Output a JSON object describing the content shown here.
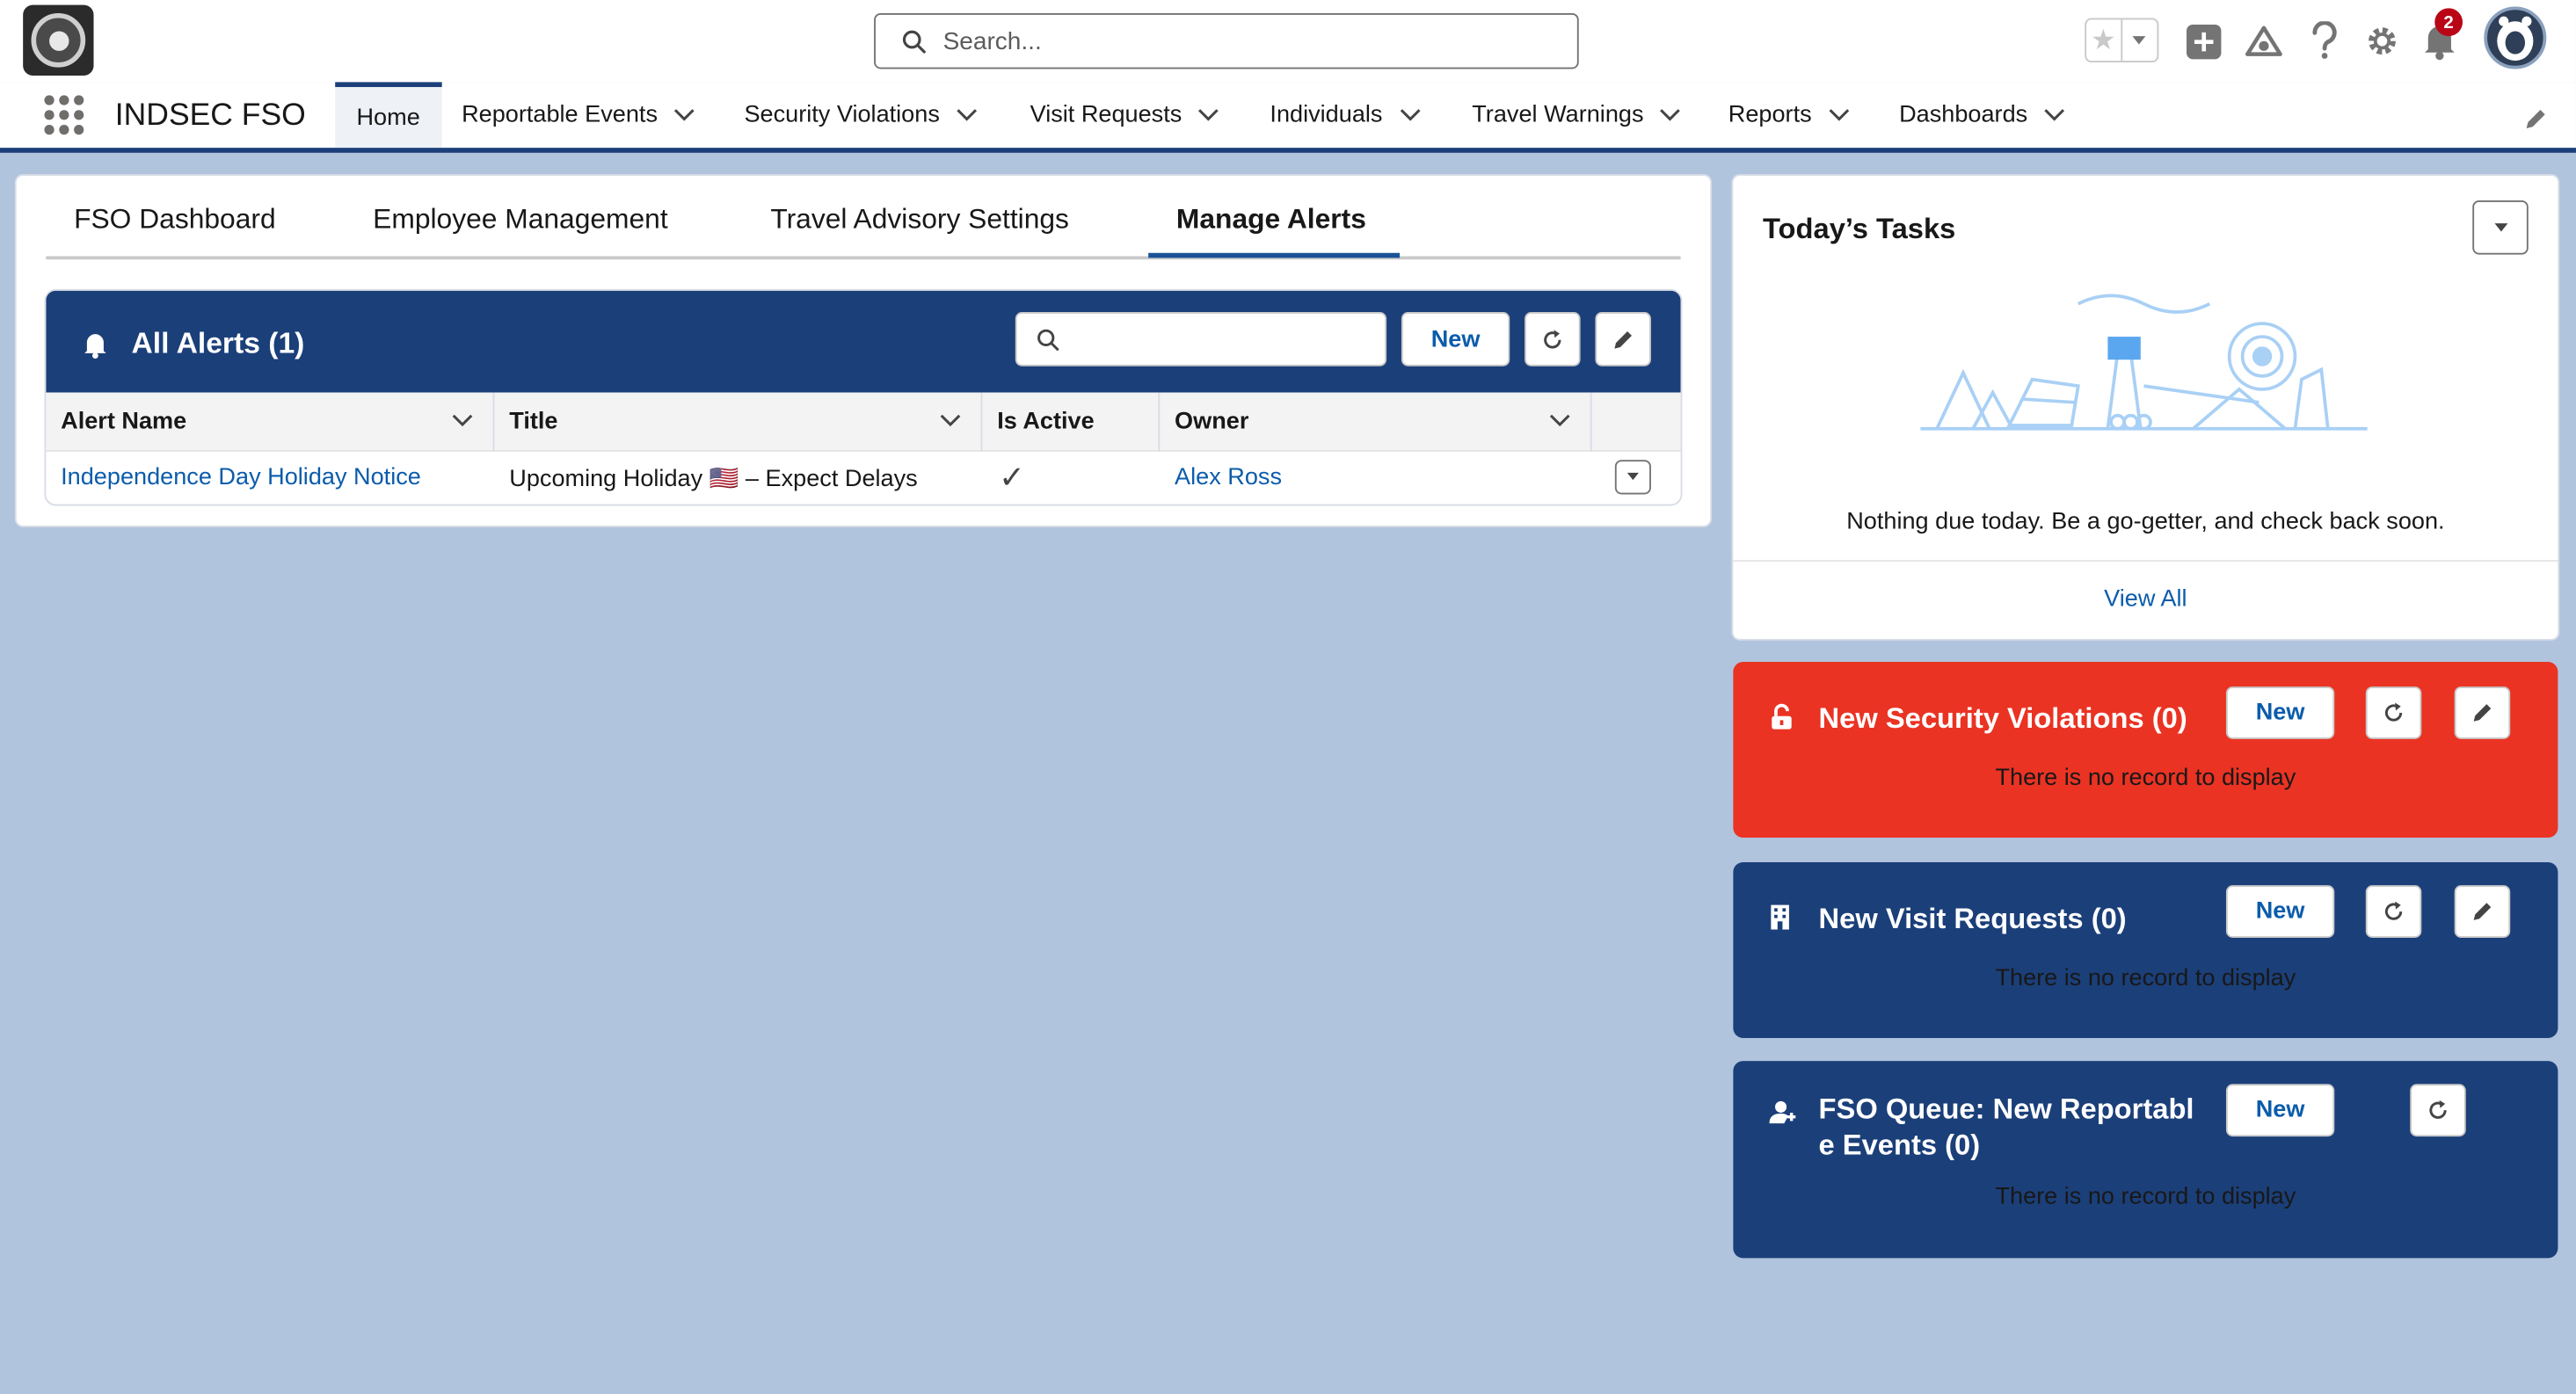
{
  "header": {
    "search_placeholder": "Search...",
    "notification_count": "2"
  },
  "nav": {
    "app_name": "INDSEC FSO",
    "items": [
      {
        "label": "Home"
      },
      {
        "label": "Reportable Events"
      },
      {
        "label": "Security Violations"
      },
      {
        "label": "Visit Requests"
      },
      {
        "label": "Individuals"
      },
      {
        "label": "Travel Warnings"
      },
      {
        "label": "Reports"
      },
      {
        "label": "Dashboards"
      }
    ]
  },
  "tabs": [
    {
      "label": "FSO Dashboard"
    },
    {
      "label": "Employee Management"
    },
    {
      "label": "Travel Advisory Settings"
    },
    {
      "label": "Manage Alerts"
    }
  ],
  "alerts": {
    "title": "All Alerts (1)",
    "new_label": "New",
    "columns": [
      "Alert Name",
      "Title",
      "Is Active",
      "Owner"
    ],
    "rows": [
      {
        "alert_name": "Independence Day Holiday Notice",
        "title": "Upcoming Holiday 🇺🇸 – Expect Delays",
        "is_active": "✓",
        "owner": "Alex Ross"
      }
    ]
  },
  "tasks": {
    "title": "Today’s Tasks",
    "empty_text": "Nothing due today. Be a go-getter, and check back soon.",
    "view_all": "View All"
  },
  "violations": {
    "title": "New Security Violations (0)",
    "new_label": "New",
    "empty_text": "There is no record to display",
    "color": "#ea3323"
  },
  "visits": {
    "title": "New Visit Requests (0)",
    "new_label": "New",
    "empty_text": "There is no record to display",
    "color": "#1b3f79"
  },
  "queue": {
    "title_line1": "FSO Queue: New Reportabl",
    "title_line2": "e Events (0)",
    "new_label": "New",
    "empty_text": "There is no record to display",
    "color": "#1b3f79"
  }
}
